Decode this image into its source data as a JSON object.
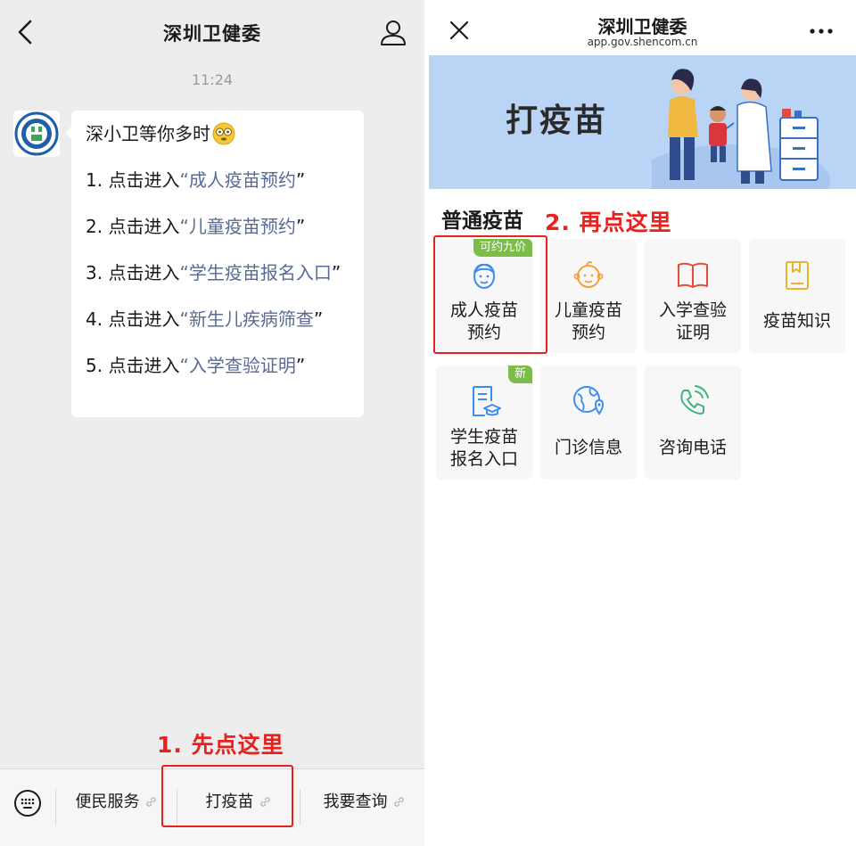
{
  "chat": {
    "title": "深圳卫健委",
    "time": "11:24",
    "greeting": "深小卫等你多时",
    "menu": [
      {
        "prefix": "1. 点击进入",
        "link": "成人疫苗预约"
      },
      {
        "prefix": "2. 点击进入",
        "link": "儿童疫苗预约"
      },
      {
        "prefix": "3. 点击进入",
        "link": "学生疫苗报名入口"
      },
      {
        "prefix": "4. 点击进入",
        "link": "新生儿疾病筛查"
      },
      {
        "prefix": "5. 点击进入",
        "link": "入学查验证明"
      }
    ],
    "open_quote": "“",
    "close_quote": "”",
    "bottom_tabs": [
      "便民服务",
      "打疫苗",
      "我要查询"
    ]
  },
  "annotations": {
    "step1": "1. 先点这里",
    "step2": "2. 再点这里"
  },
  "webview": {
    "title": "深圳卫健委",
    "url": "app.gov.shencom.cn",
    "banner_text": "打疫苗",
    "section_title": "普通疫苗",
    "cards": [
      {
        "label": "成人疫苗\n预约",
        "badge": "可约九价",
        "icon": "adult-face-icon"
      },
      {
        "label": "儿童疫苗\n预约",
        "badge": "",
        "icon": "child-face-icon"
      },
      {
        "label": "入学查验\n证明",
        "badge": "",
        "icon": "book-icon"
      },
      {
        "label": "疫苗知识",
        "badge": "",
        "icon": "bookmark-book-icon"
      },
      {
        "label": "学生疫苗\n报名入口",
        "badge": "新",
        "icon": "graduation-doc-icon"
      },
      {
        "label": "门诊信息",
        "badge": "",
        "icon": "globe-location-icon"
      },
      {
        "label": "咨询电话",
        "badge": "",
        "icon": "phone-icon"
      }
    ]
  },
  "colors": {
    "link": "#576b95",
    "annotation_red": "#e8211f",
    "badge_green": "#7cbd4a",
    "icon_blue": "#3b8ef0",
    "icon_orange": "#f0a13b",
    "icon_red": "#e84a3b",
    "icon_yellow": "#e8b52a",
    "icon_green": "#3fb27f",
    "banner_bg": "#bad4f5"
  }
}
